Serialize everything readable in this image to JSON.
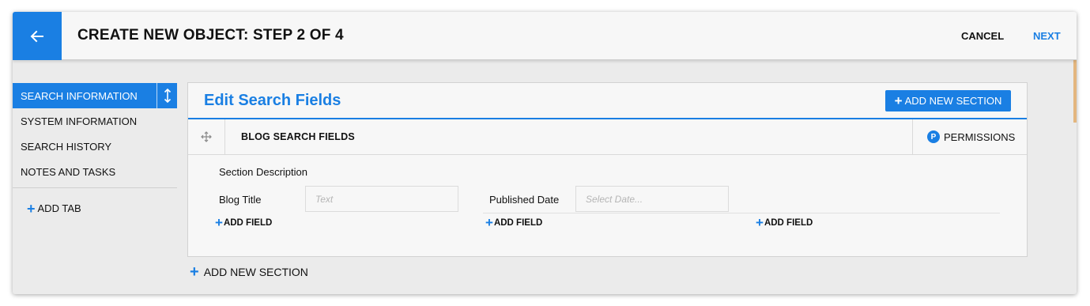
{
  "header": {
    "title": "CREATE NEW OBJECT: STEP 2 OF 4",
    "cancel_label": "CANCEL",
    "next_label": "NEXT",
    "back_icon": "arrow-left-icon"
  },
  "sidebar": {
    "tabs": [
      {
        "label": "SEARCH INFORMATION",
        "active": true
      },
      {
        "label": "SYSTEM INFORMATION",
        "active": false
      },
      {
        "label": "SEARCH HISTORY",
        "active": false
      },
      {
        "label": "NOTES AND TASKS",
        "active": false
      }
    ],
    "add_tab_label": "ADD TAB"
  },
  "panel": {
    "title": "Edit Search Fields",
    "add_section_label": "ADD NEW SECTION",
    "section": {
      "name": "BLOG SEARCH FIELDS",
      "permissions_label": "PERMISSIONS",
      "permissions_badge": "P",
      "description_label": "Section Description",
      "fields": [
        {
          "label": "Blog Title",
          "placeholder": "Text"
        },
        {
          "label": "Published Date",
          "placeholder": "Select Date..."
        }
      ],
      "add_field_label": "ADD FIELD"
    }
  },
  "footer": {
    "add_new_section_label": "ADD NEW SECTION"
  },
  "colors": {
    "accent": "#1a7fe3",
    "background": "#ebebeb",
    "panel": "#f7f7f7"
  }
}
